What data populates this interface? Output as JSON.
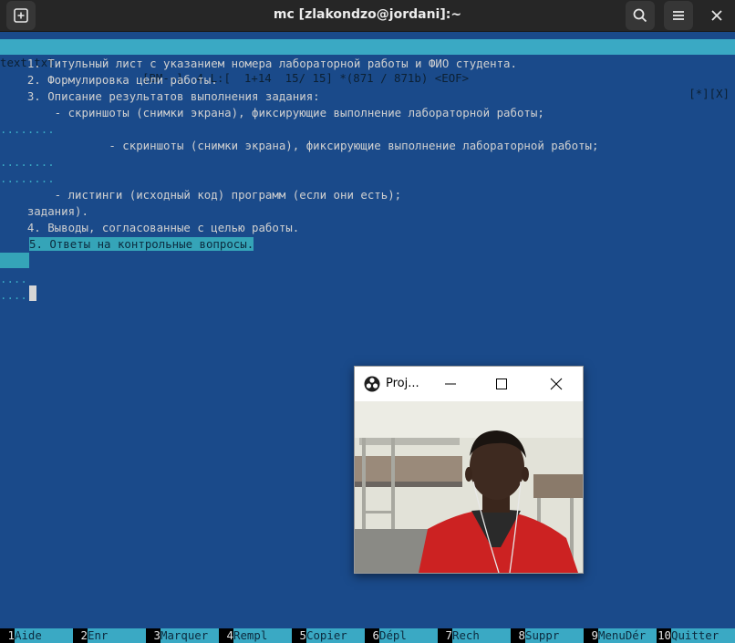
{
  "window": {
    "title": "mc [zlakondzo@jordani]:~",
    "icons": {
      "new_tab": "new-tab-icon",
      "search": "search-icon",
      "menu": "hamburger-menu-icon",
      "close": "close-icon"
    }
  },
  "status": {
    "filename": "text.txt",
    "info": "[BM--]  4 L:[  1+14  15/ 15] *(871 / 871b) <EOF>",
    "flags": "[*][X]"
  },
  "editor": {
    "lines": [
      "    1. Титульный лист с указанием номера лабораторной работы и ФИО студента.",
      "    2. Формулировка цели работы.",
      "    3. Описание результатов выполнения задания:",
      "        - скриншоты (снимки экрана), фиксирующие выполнение лабораторной работы;",
      "........",
      "                - скриншоты (снимки экрана), фиксирующие выполнение лабораторной работы;",
      "........",
      "........",
      "        - листинги (исходный код) программ (если они есть);",
      "    задания).",
      "    4. Выводы, согласованные с целью работы.",
      "5. Ответы на контрольные вопросы.",
      "",
      "....",
      "...."
    ]
  },
  "fkeys": [
    {
      "num": "1",
      "label": "Aide"
    },
    {
      "num": "2",
      "label": "Enr"
    },
    {
      "num": "3",
      "label": "Marquer"
    },
    {
      "num": "4",
      "label": "Rempl"
    },
    {
      "num": "5",
      "label": "Copier"
    },
    {
      "num": "6",
      "label": "Dépl"
    },
    {
      "num": "7",
      "label": "Rech"
    },
    {
      "num": "8",
      "label": "Suppr"
    },
    {
      "num": "9",
      "label": "MenuDér"
    },
    {
      "num": "10",
      "label": "Quitter"
    }
  ],
  "projector": {
    "title": "Proj...",
    "icons": {
      "app": "obs-icon",
      "minimize": "minimize-icon",
      "maximize": "maximize-icon",
      "close": "close-icon"
    },
    "content": "webcam-preview"
  }
}
